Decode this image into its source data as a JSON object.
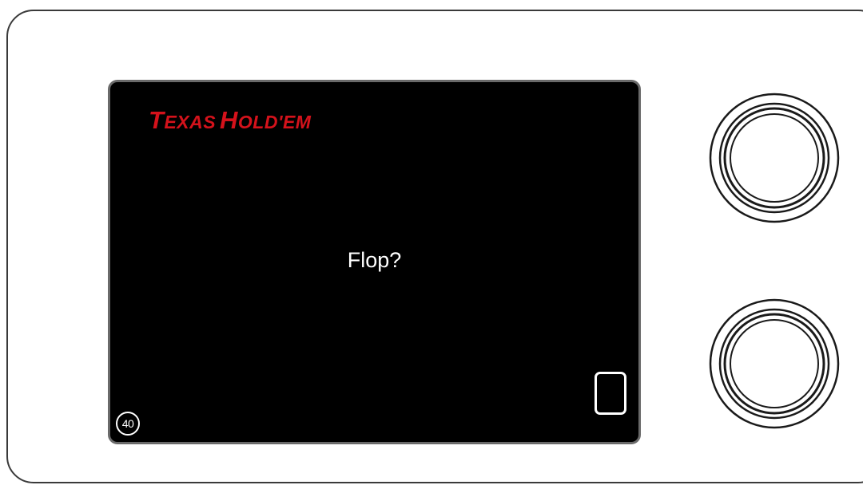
{
  "game": {
    "title_first_initial": "T",
    "title_first_rest": "EXAS",
    "title_second_initial": "H",
    "title_second_rest": "OLD'EM",
    "prompt": "Flop?",
    "counter": "40"
  },
  "colors": {
    "title": "#d4121b",
    "screen": "#000000",
    "text": "#ffffff"
  },
  "icons": {
    "card_button": "card-outline-icon",
    "top_knob": "knob-icon",
    "bottom_knob": "knob-icon"
  }
}
